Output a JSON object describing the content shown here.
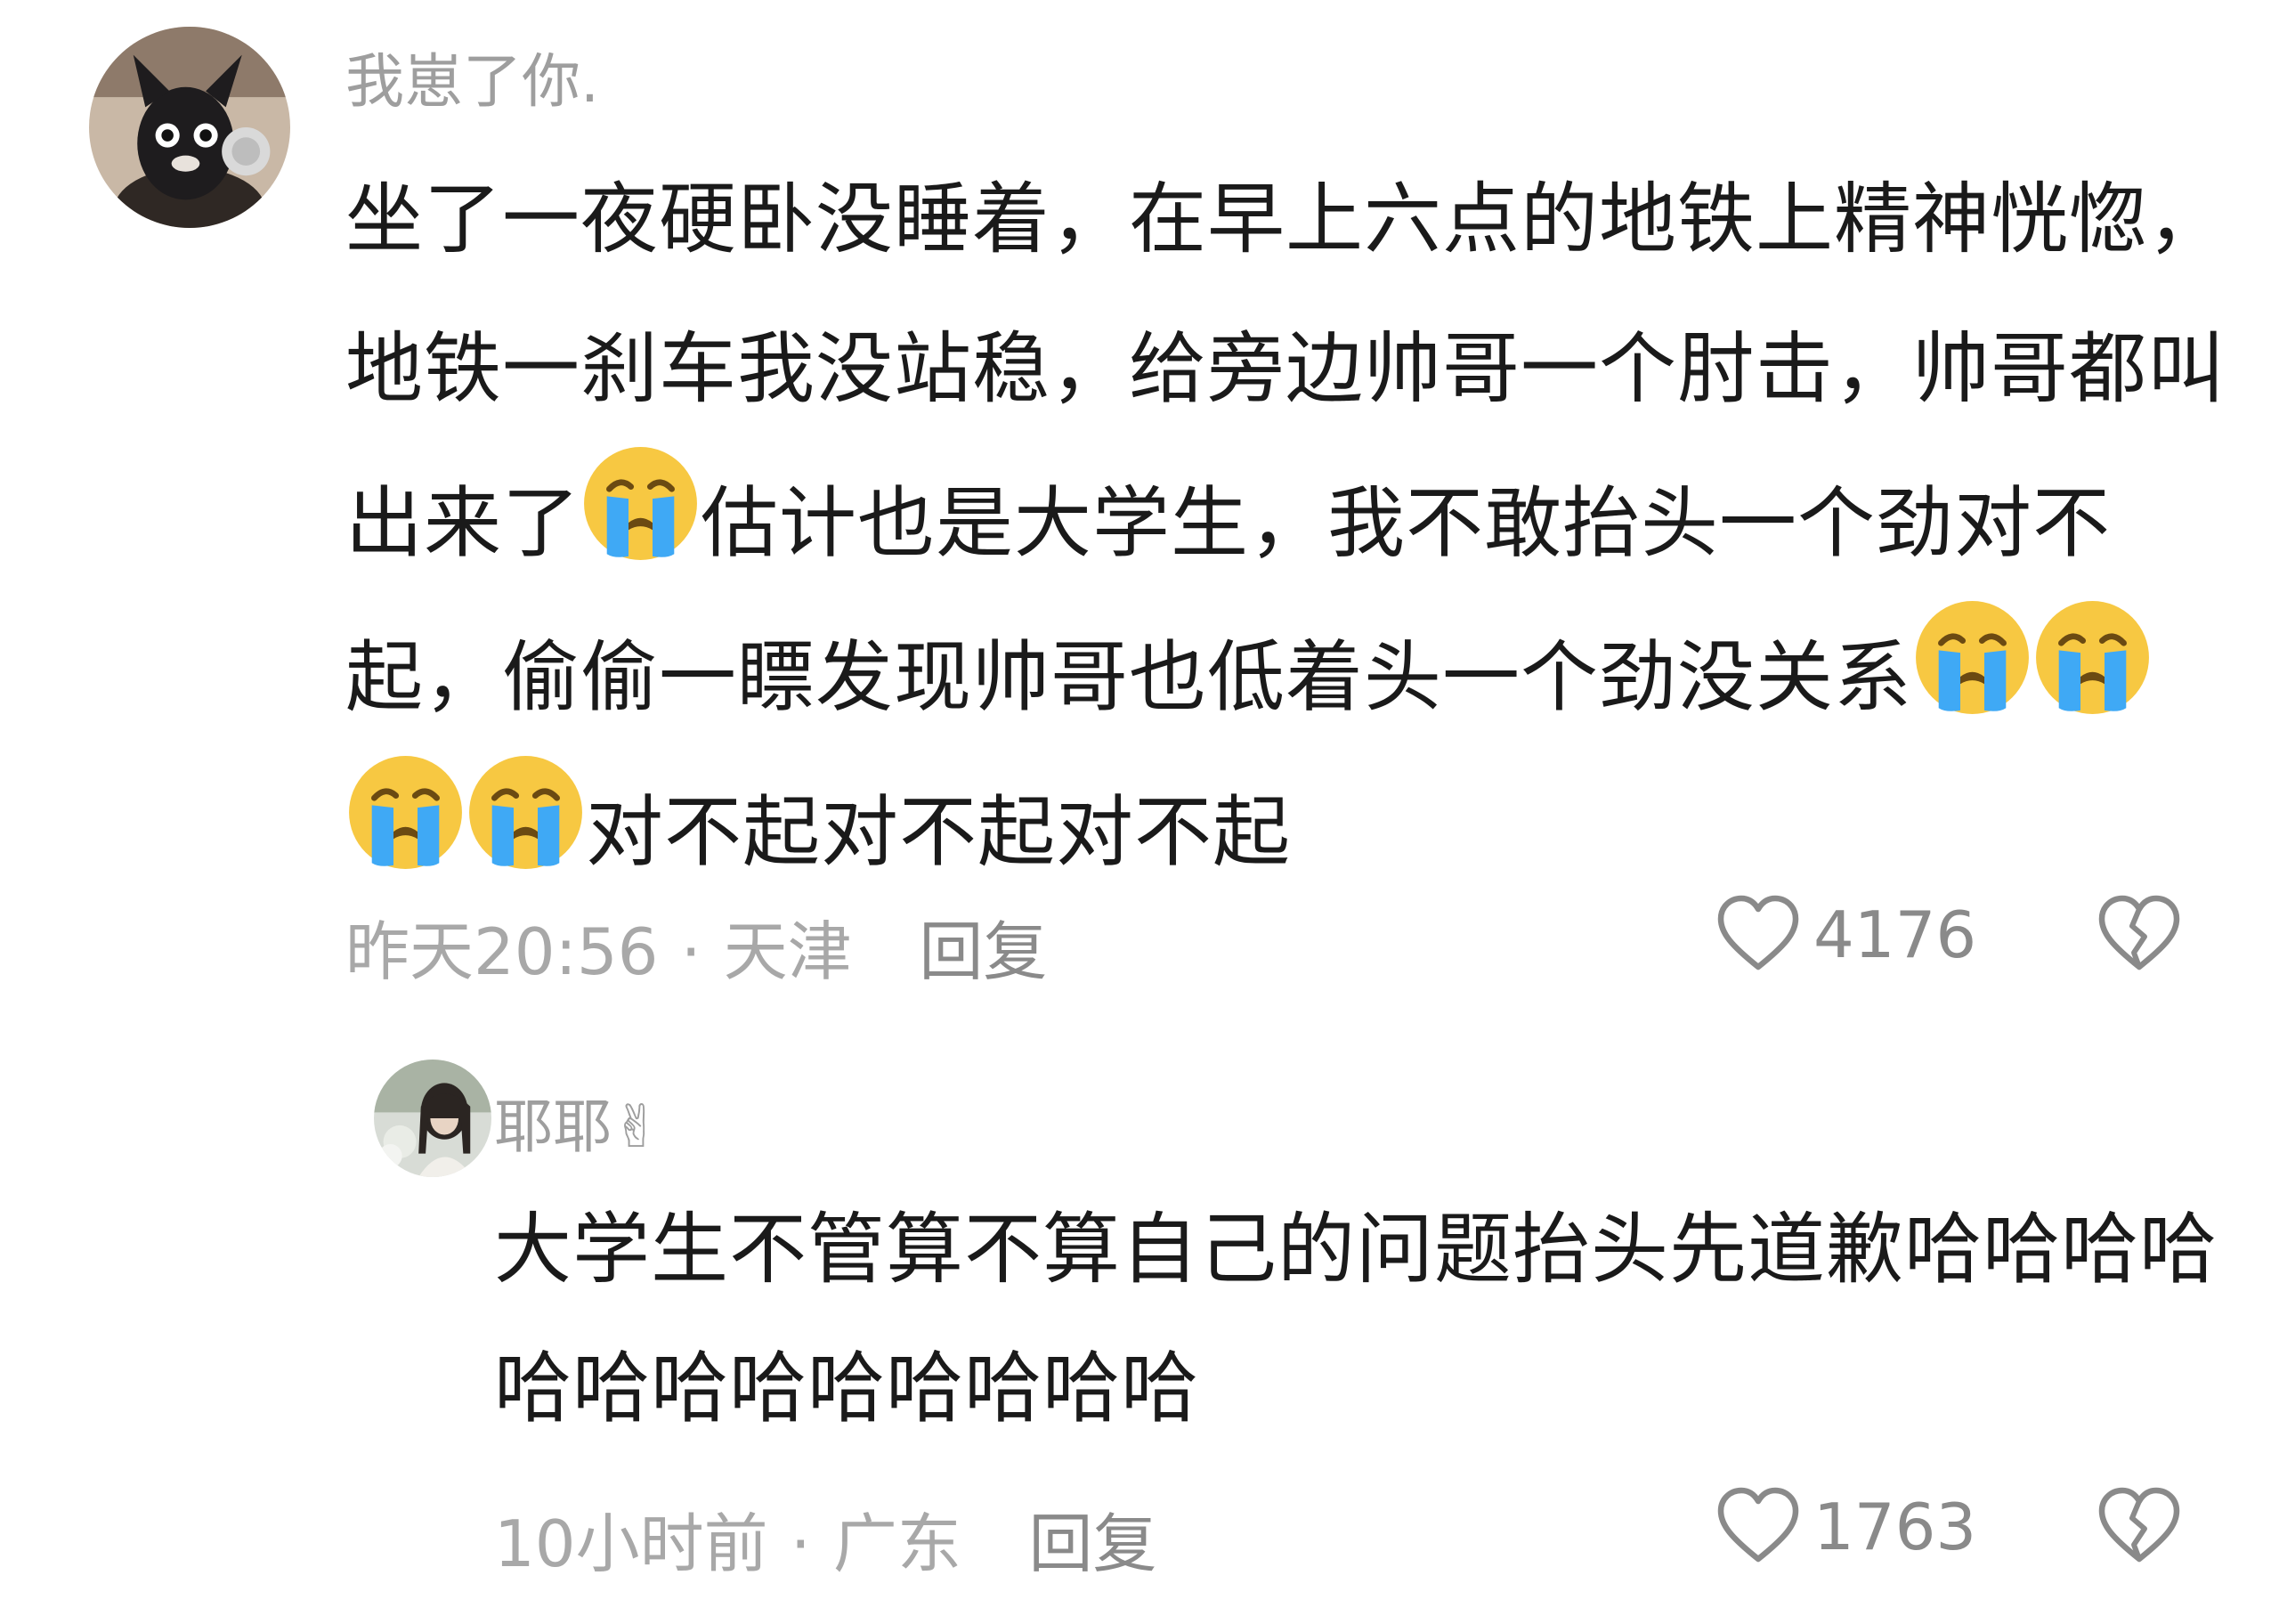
{
  "comments": [
    {
      "username": "我崽了你.",
      "avatar_icon": "cat-mask-avatar",
      "text_parts": [
        "坐了一夜硬卧没睡着，在早上六点的地铁上精神恍惚，地铁一刹车我没站稳，给旁边帅哥一个肘击，帅哥都叫出来了",
        "估计也是大学生，我不敢抬头一个劲对不起，偷偷一瞟发现帅哥也低着头一个劲没关系",
        "对不起对不起对不起"
      ],
      "emoji_name": "loudly-crying-face-emoji",
      "time": "昨天20:56",
      "separator": "·",
      "location": "天津",
      "reply_label": "回复",
      "like_count": "4176",
      "like_icon": "heart-outline-icon",
      "dislike_icon": "broken-heart-icon"
    },
    {
      "username": "耶耶",
      "username_emoji": "✌",
      "avatar_icon": "girl-photo-avatar",
      "text": "大学生不管算不算自己的问题抬头先道歉哈哈哈哈哈哈哈哈哈哈哈哈哈",
      "time": "10小时前",
      "separator": "·",
      "location": "广东",
      "reply_label": "回复",
      "like_count": "1763",
      "like_icon": "heart-outline-icon",
      "dislike_icon": "broken-heart-icon"
    }
  ],
  "colors": {
    "background": "#ffffff",
    "body_text": "#1a1a1a",
    "username": "#9e9e9e",
    "meta_text": "#a8a8a8",
    "emoji_face": "#f7c842",
    "emoji_tears": "#3fa9f5"
  }
}
